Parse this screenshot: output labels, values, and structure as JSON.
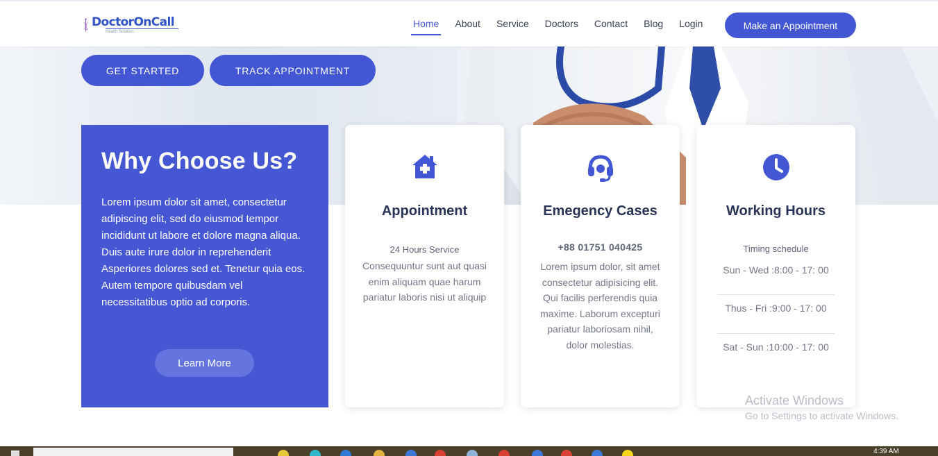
{
  "brand": {
    "name": "DoctorOnCall",
    "tagline": "Health Solution",
    "color": "#3154c8"
  },
  "nav": {
    "items": [
      {
        "label": "Home",
        "active": true
      },
      {
        "label": "About"
      },
      {
        "label": "Service"
      },
      {
        "label": "Doctors"
      },
      {
        "label": "Contact"
      },
      {
        "label": "Blog"
      },
      {
        "label": "Login"
      }
    ],
    "cta": "Make an Appointment"
  },
  "hero": {
    "primary_button": "GET STARTED",
    "secondary_button": "TRACK APPOINTMENT"
  },
  "why": {
    "title": "Why Choose Us?",
    "text": "Lorem ipsum dolor sit amet, consectetur adipiscing elit, sed do eiusmod tempor incididunt ut labore et dolore magna aliqua. Duis aute irure dolor in reprehenderit Asperiores dolores sed et. Tenetur quia eos. Autem tempore quibusdam vel necessitatibus optio ad corporis.",
    "button": "Learn More"
  },
  "cards": {
    "appointment": {
      "icon": "house-medical-icon",
      "title": "Appointment",
      "subtitle": "24 Hours Service",
      "text": "Consequuntur sunt aut quasi enim aliquam quae harum pariatur laboris nisi ut aliquip"
    },
    "emergency": {
      "icon": "headset-icon",
      "title": "Emegency Cases",
      "phone": "+88 01751 040425",
      "text": "Lorem ipsum dolor, sit amet consectetur adipisicing elit. Qui facilis perferendis quia maxime. Laborum excepturi pariatur laboriosam nihil, dolor molestias."
    },
    "hours": {
      "icon": "clock-icon",
      "title": "Working Hours",
      "subtitle": "Timing schedule",
      "rows": [
        "Sun - Wed :8:00 - 17: 00",
        "Thus - Fri :9:00 - 17: 00",
        "Sat - Sun :10:00 - 17: 00"
      ]
    }
  },
  "watermark": {
    "line1": "Activate Windows",
    "line2": "Go to Settings to activate Windows."
  },
  "taskbar": {
    "time": "4:39 AM"
  },
  "colors": {
    "accent": "#4357d4",
    "why_bg": "#4657d4",
    "learn_bg": "#6475e0",
    "heading": "#283455"
  }
}
